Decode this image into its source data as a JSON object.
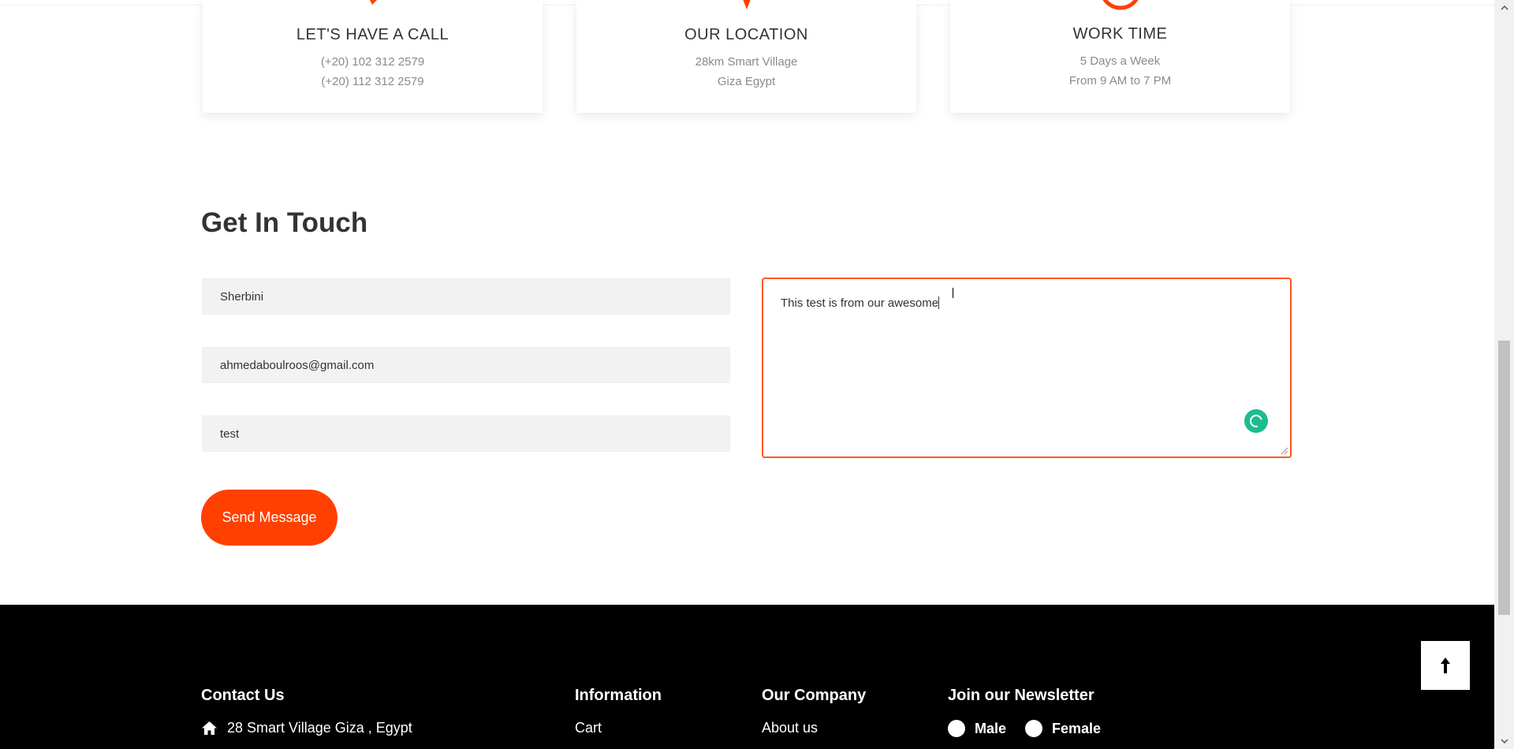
{
  "cards": [
    {
      "title": "LET'S HAVE A CALL",
      "line1": "(+20) 102 312 2579",
      "line2": "(+20) 112 312 2579",
      "icon": "phone-icon"
    },
    {
      "title": "OUR LOCATION",
      "line1": "28km Smart Village",
      "line2": "Giza Egypt",
      "icon": "map-pin-icon"
    },
    {
      "title": "WORK TIME",
      "line1": "5 Days a Week",
      "line2": "From 9 AM to 7 PM",
      "icon": "clock-icon"
    }
  ],
  "contact_form": {
    "title": "Get In Touch",
    "name_value": "Sherbini",
    "email_value": "ahmedaboulroos@gmail.com",
    "subject_value": "test",
    "message_value": "This test is from our awesome",
    "send_label": "Send Message"
  },
  "footer": {
    "contact_heading": "Contact Us",
    "address": "28 Smart Village Giza , Egypt",
    "information_heading": "Information",
    "information_items": [
      "Cart"
    ],
    "company_heading": "Our Company",
    "company_items": [
      "About us"
    ],
    "newsletter_heading": "Join our Newsletter",
    "gender_options": [
      "Male",
      "Female"
    ]
  },
  "colors": {
    "accent": "#ff4000",
    "footer_bg": "#000000",
    "spinner": "#1bbd8f"
  }
}
